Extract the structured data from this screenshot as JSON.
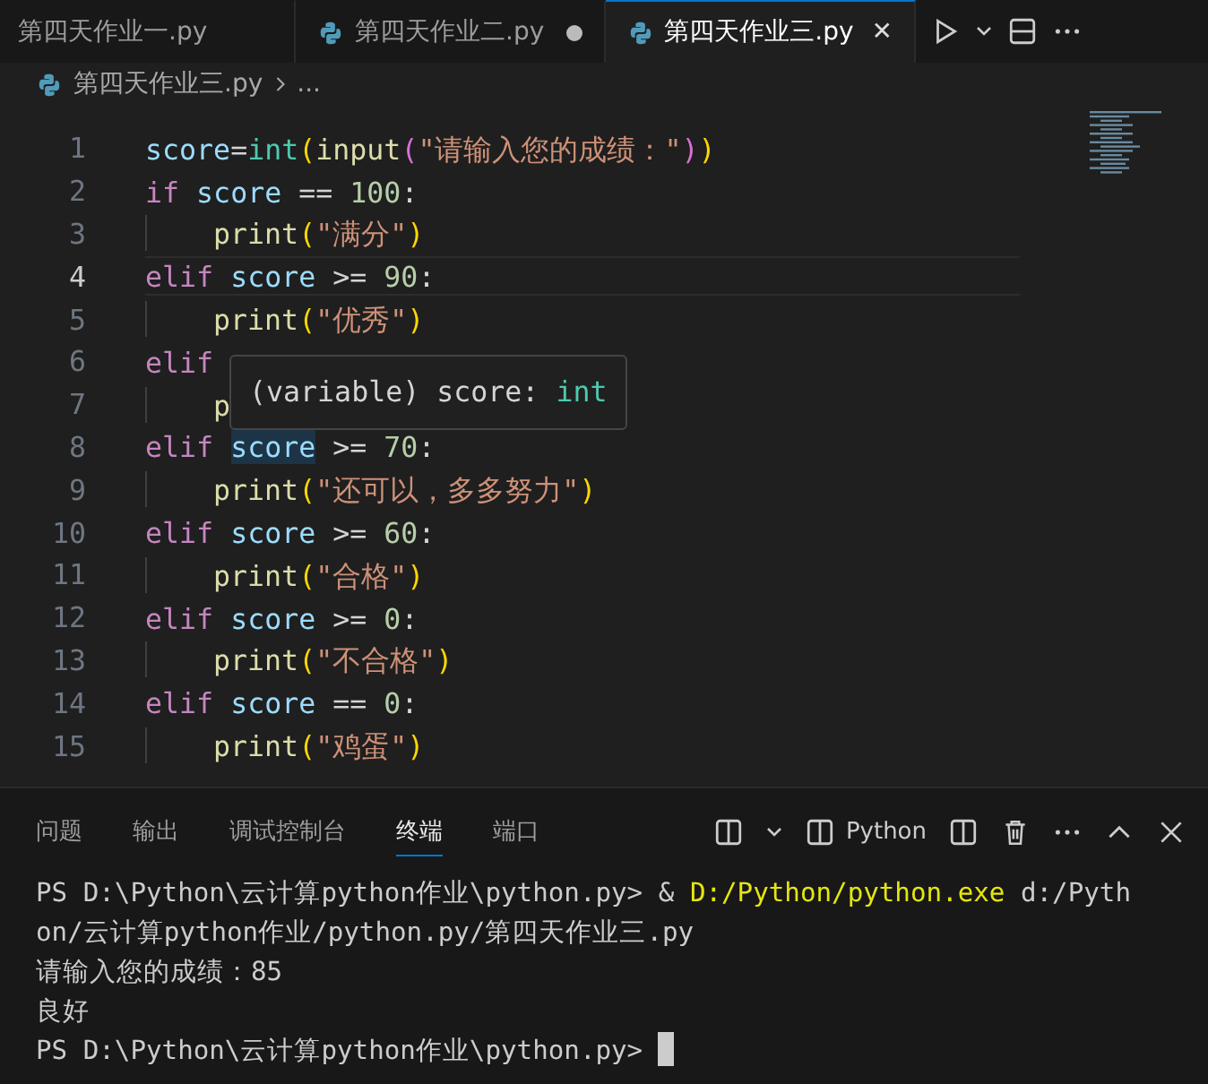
{
  "tabs": [
    {
      "label": "第四天作业一.py",
      "selected": false,
      "modified": false
    },
    {
      "label": "第四天作业二.py",
      "selected": false,
      "modified": true
    },
    {
      "label": "第四天作业三.py",
      "selected": true,
      "modified": false,
      "close": "✕"
    }
  ],
  "breadcrumb": {
    "file": "第四天作业三.py",
    "rest": "..."
  },
  "lines": [
    {
      "number": "1",
      "current": false,
      "indent": false,
      "tokens": [
        {
          "kind": "var",
          "text": "score"
        },
        {
          "kind": "op",
          "text": "="
        },
        {
          "kind": "cls",
          "text": "int"
        },
        {
          "kind": "p1",
          "text": "("
        },
        {
          "kind": "fn",
          "text": "input"
        },
        {
          "kind": "p2",
          "text": "("
        },
        {
          "kind": "str",
          "text": "\"请输入您的成绩：\""
        },
        {
          "kind": "p2",
          "text": ")"
        },
        {
          "kind": "p1",
          "text": ")"
        }
      ]
    },
    {
      "number": "2",
      "current": false,
      "indent": false,
      "tokens": [
        {
          "kind": "kw",
          "text": "if "
        },
        {
          "kind": "var",
          "text": "score"
        },
        {
          "kind": "op",
          "text": " == "
        },
        {
          "kind": "num",
          "text": "100"
        },
        {
          "kind": "op",
          "text": ":"
        }
      ]
    },
    {
      "number": "3",
      "current": false,
      "indent": true,
      "tokens": [
        {
          "kind": "fn",
          "text": "print"
        },
        {
          "kind": "p1",
          "text": "("
        },
        {
          "kind": "str",
          "text": "\"满分\""
        },
        {
          "kind": "p1",
          "text": ")"
        }
      ]
    },
    {
      "number": "4",
      "current": true,
      "indent": false,
      "tokens": [
        {
          "kind": "kw",
          "text": "elif "
        },
        {
          "kind": "var",
          "text": "score"
        },
        {
          "kind": "op",
          "text": " >= "
        },
        {
          "kind": "num",
          "text": "90"
        },
        {
          "kind": "op",
          "text": ":"
        }
      ]
    },
    {
      "number": "5",
      "current": false,
      "indent": true,
      "tokens": [
        {
          "kind": "fn",
          "text": "print"
        },
        {
          "kind": "p1",
          "text": "("
        },
        {
          "kind": "str",
          "text": "\"优秀\""
        },
        {
          "kind": "p1",
          "text": ")"
        }
      ]
    },
    {
      "number": "6",
      "current": false,
      "indent": false,
      "tokens": [
        {
          "kind": "kw",
          "text": "elif"
        }
      ]
    },
    {
      "number": "7",
      "current": false,
      "indent": true,
      "tokens": [
        {
          "kind": "fn",
          "text": "p"
        }
      ]
    },
    {
      "number": "8",
      "current": false,
      "indent": false,
      "tokens": [
        {
          "kind": "kw",
          "text": "elif "
        },
        {
          "kind": "var",
          "text": "score",
          "highlighted": true
        },
        {
          "kind": "op",
          "text": " >= "
        },
        {
          "kind": "num",
          "text": "70"
        },
        {
          "kind": "op",
          "text": ":"
        }
      ]
    },
    {
      "number": "9",
      "current": false,
      "indent": true,
      "tokens": [
        {
          "kind": "fn",
          "text": "print"
        },
        {
          "kind": "p1",
          "text": "("
        },
        {
          "kind": "str",
          "text": "\"还可以，多多努力\""
        },
        {
          "kind": "p1",
          "text": ")"
        }
      ]
    },
    {
      "number": "10",
      "current": false,
      "indent": false,
      "tokens": [
        {
          "kind": "kw",
          "text": "elif "
        },
        {
          "kind": "var",
          "text": "score"
        },
        {
          "kind": "op",
          "text": " >= "
        },
        {
          "kind": "num",
          "text": "60"
        },
        {
          "kind": "op",
          "text": ":"
        }
      ]
    },
    {
      "number": "11",
      "current": false,
      "indent": true,
      "tokens": [
        {
          "kind": "fn",
          "text": "print"
        },
        {
          "kind": "p1",
          "text": "("
        },
        {
          "kind": "str",
          "text": "\"合格\""
        },
        {
          "kind": "p1",
          "text": ")"
        }
      ]
    },
    {
      "number": "12",
      "current": false,
      "indent": false,
      "tokens": [
        {
          "kind": "kw",
          "text": "elif "
        },
        {
          "kind": "var",
          "text": "score"
        },
        {
          "kind": "op",
          "text": " >= "
        },
        {
          "kind": "num",
          "text": "0"
        },
        {
          "kind": "op",
          "text": ":"
        }
      ]
    },
    {
      "number": "13",
      "current": false,
      "indent": true,
      "tokens": [
        {
          "kind": "fn",
          "text": "print"
        },
        {
          "kind": "p1",
          "text": "("
        },
        {
          "kind": "str",
          "text": "\"不合格\""
        },
        {
          "kind": "p1",
          "text": ")"
        }
      ]
    },
    {
      "number": "14",
      "current": false,
      "indent": false,
      "tokens": [
        {
          "kind": "kw",
          "text": "elif "
        },
        {
          "kind": "var",
          "text": "score"
        },
        {
          "kind": "op",
          "text": " == "
        },
        {
          "kind": "num",
          "text": "0"
        },
        {
          "kind": "op",
          "text": ":"
        }
      ]
    },
    {
      "number": "15",
      "current": false,
      "indent": true,
      "tokens": [
        {
          "kind": "fn",
          "text": "print"
        },
        {
          "kind": "p1",
          "text": "("
        },
        {
          "kind": "str",
          "text": "\"鸡蛋\""
        },
        {
          "kind": "p1",
          "text": ")"
        }
      ]
    }
  ],
  "hover": {
    "tokens": [
      {
        "kind": "op",
        "text": "(variable) score: "
      },
      {
        "kind": "cls",
        "text": "int"
      }
    ]
  },
  "panel": {
    "tabs": [
      {
        "label": "问题",
        "selected": false
      },
      {
        "label": "输出",
        "selected": false
      },
      {
        "label": "调试控制台",
        "selected": false
      },
      {
        "label": "终端",
        "selected": true
      },
      {
        "label": "端口",
        "selected": false
      }
    ],
    "terminal_name": "Python",
    "terminal": [
      [
        {
          "kind": "plain",
          "text": "PS D:\\Python\\云计算python作业\\python.py> & "
        },
        {
          "kind": "cmd",
          "text": "D:/Python/python.exe"
        },
        {
          "kind": "plain",
          "text": " d:/Pyth"
        }
      ],
      [
        {
          "kind": "plain",
          "text": "on/云计算python作业/python.py/第四天作业三.py"
        }
      ],
      [
        {
          "kind": "plain",
          "text": "请输入您的成绩：85"
        }
      ],
      [
        {
          "kind": "plain",
          "text": "良好"
        }
      ],
      [
        {
          "kind": "plain",
          "text": "PS D:\\Python\\云计算python作业\\python.py> "
        },
        {
          "kind": "cursor"
        }
      ]
    ]
  }
}
